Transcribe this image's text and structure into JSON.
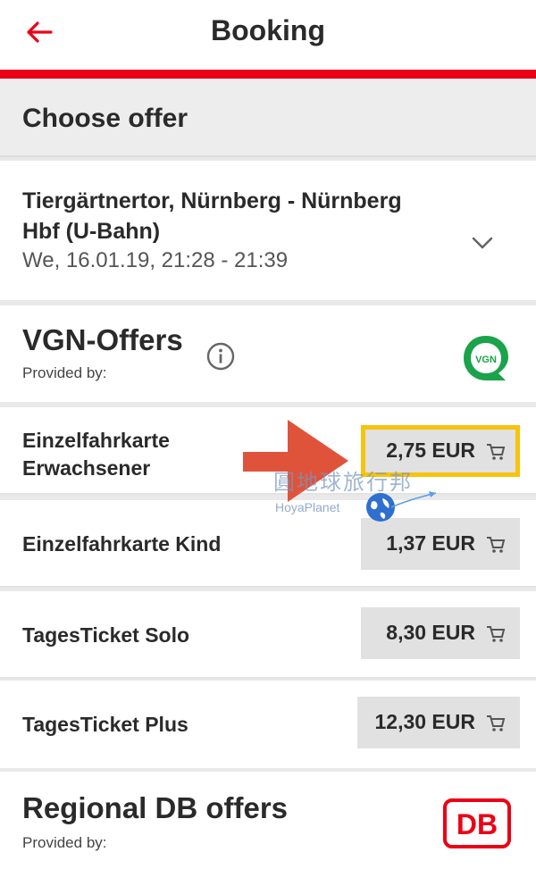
{
  "header": {
    "title": "Booking"
  },
  "section": {
    "title": "Choose offer"
  },
  "connection": {
    "route": "Tiergärtnertor, Nürnberg - Nürnberg Hbf (U-Bahn)",
    "datetime": "We, 16.01.19, 21:28 - 21:39"
  },
  "vgn": {
    "name": "VGN-Offers",
    "provided_by": "Provided by:",
    "logo_text": "VGN",
    "offers": [
      {
        "label": "Einzelfahrkarte Erwachsener",
        "price": "2,75 EUR"
      },
      {
        "label": "Einzelfahrkarte Kind",
        "price": "1,37 EUR"
      },
      {
        "label": "TagesTicket Solo",
        "price": "8,30 EUR"
      },
      {
        "label": "TagesTicket Plus",
        "price": "12,30 EUR"
      }
    ]
  },
  "watermark": {
    "text": "圓地球旅行邦",
    "sub": "HoyaPlanet"
  },
  "regional": {
    "name": "Regional DB offers",
    "provided_by": "Provided by:",
    "logo_text": "DB"
  },
  "colors": {
    "brand_red": "#ec0016",
    "highlight": "#f7c30d",
    "arrow": "#e0533b",
    "vgn_green": "#1aa34a"
  },
  "icons": [
    "back-arrow-icon",
    "chevron-down-icon",
    "info-icon",
    "vgn-logo",
    "cart-icon",
    "db-logo",
    "annotation-arrow",
    "globe-icon"
  ]
}
